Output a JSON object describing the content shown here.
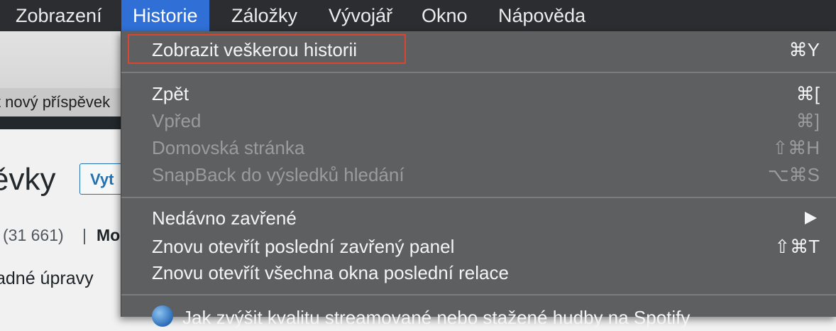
{
  "menubar": {
    "items": [
      "Zobrazení",
      "Historie",
      "Záložky",
      "Vývojář",
      "Okno",
      "Nápověda"
    ],
    "active": "Historie"
  },
  "background": {
    "tab_text": "it nový příspěvek",
    "page_title": "ěvky",
    "add_button": "Vyt",
    "count_text": "(31 661)",
    "separator": "|",
    "mine_text": "Mo",
    "edits_text": "adné úpravy"
  },
  "menu": {
    "show_all": {
      "label": "Zobrazit veškerou historii",
      "shortcut": "⌘Y"
    },
    "back": {
      "label": "Zpět",
      "shortcut": "⌘["
    },
    "forward": {
      "label": "Vpřed",
      "shortcut": "⌘]"
    },
    "home": {
      "label": "Domovská stránka",
      "shortcut": "⇧⌘H"
    },
    "snapback": {
      "label": "SnapBack do výsledků hledání",
      "shortcut": "⌥⌘S"
    },
    "recently_closed": {
      "label": "Nedávno zavřené"
    },
    "reopen_tab": {
      "label": "Znovu otevřít poslední zavřený panel",
      "shortcut": "⇧⌘T"
    },
    "reopen_windows": {
      "label": "Znovu otevřít všechna okna poslední relace"
    },
    "history_item": {
      "label": "Jak zvýšit kvalitu streamované nebo stažené hudby na Spotify",
      "icon": "globe-icon"
    }
  },
  "colors": {
    "menubar_bg": "#2c2d30",
    "active_menu": "#2f6fd6",
    "menu_bg": "#5e5f61",
    "highlight_box": "#d9452f"
  }
}
